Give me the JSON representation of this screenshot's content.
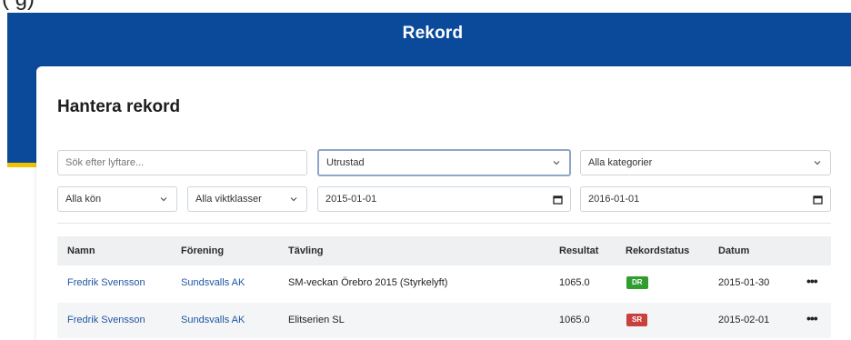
{
  "page": {
    "title": "Rekord"
  },
  "top_caption": "(                         g)",
  "card": {
    "title": "Hantera rekord"
  },
  "filters": {
    "search_placeholder": "Sök efter lyftare...",
    "equipment": "Utrustad",
    "category": "Alla kategorier",
    "gender": "Alla kön",
    "weight_class": "Alla viktklasser",
    "date_from": "2015-01-01",
    "date_to": "2016-01-01"
  },
  "table": {
    "headers": {
      "name": "Namn",
      "club": "Förening",
      "competition": "Tävling",
      "result": "Resultat",
      "record_status": "Rekordstatus",
      "date": "Datum"
    },
    "rows": [
      {
        "name": "Fredrik Svensson",
        "club": "Sundsvalls AK",
        "competition": "SM-veckan Örebro 2015 (Styrkelyft)",
        "result": "1065.0",
        "status": "DR",
        "date": "2015-01-30",
        "more": "•••"
      },
      {
        "name": "Fredrik Svensson",
        "club": "Sundsvalls AK",
        "competition": "Elitserien SL",
        "result": "1065.0",
        "status": "SR",
        "date": "2015-02-01",
        "more": "•••"
      }
    ]
  },
  "colors": {
    "banner": "#0b4a9a",
    "accent_stripe": "#f2c300",
    "link": "#1f56a3",
    "badge_dr": "#2f9e2f",
    "badge_sr": "#c9413f"
  },
  "icons": [
    "chevron-down-icon",
    "calendar-icon",
    "more-icon"
  ]
}
